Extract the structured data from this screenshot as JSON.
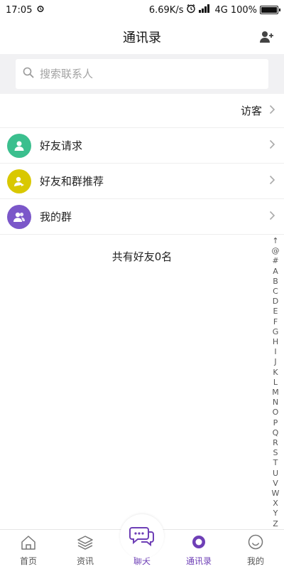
{
  "status_bar": {
    "time": "17:05",
    "network_speed": "6.69K/s",
    "network_type": "4G",
    "battery": "100%",
    "battery_level": 1.0
  },
  "header": {
    "title": "通讯录"
  },
  "search": {
    "placeholder": "搜索联系人"
  },
  "visitor": {
    "label": "访客"
  },
  "rows": [
    {
      "label": "好友请求",
      "color": "#3bbf8e"
    },
    {
      "label": "好友和群推荐",
      "color": "#d9c800"
    },
    {
      "label": "我的群",
      "color": "#7b57c9"
    }
  ],
  "friend_count_text": "共有好友0名",
  "index_letters": [
    "↑",
    "@",
    "#",
    "A",
    "B",
    "C",
    "D",
    "E",
    "F",
    "G",
    "H",
    "I",
    "J",
    "K",
    "L",
    "M",
    "N",
    "O",
    "P",
    "Q",
    "R",
    "S",
    "T",
    "U",
    "V",
    "W",
    "X",
    "Y",
    "Z"
  ],
  "bottom_nav": [
    {
      "label": "首页",
      "icon": "home-icon"
    },
    {
      "label": "资讯",
      "icon": "layers-icon"
    },
    {
      "label": "聊天",
      "icon": "chat-bubbles-icon"
    },
    {
      "label": "通讯录",
      "icon": "contacts-ring-icon"
    },
    {
      "label": "我的",
      "icon": "smiley-icon"
    }
  ],
  "colors": {
    "accent": "#6e3fb6",
    "search_bg": "#f1f1f3"
  }
}
